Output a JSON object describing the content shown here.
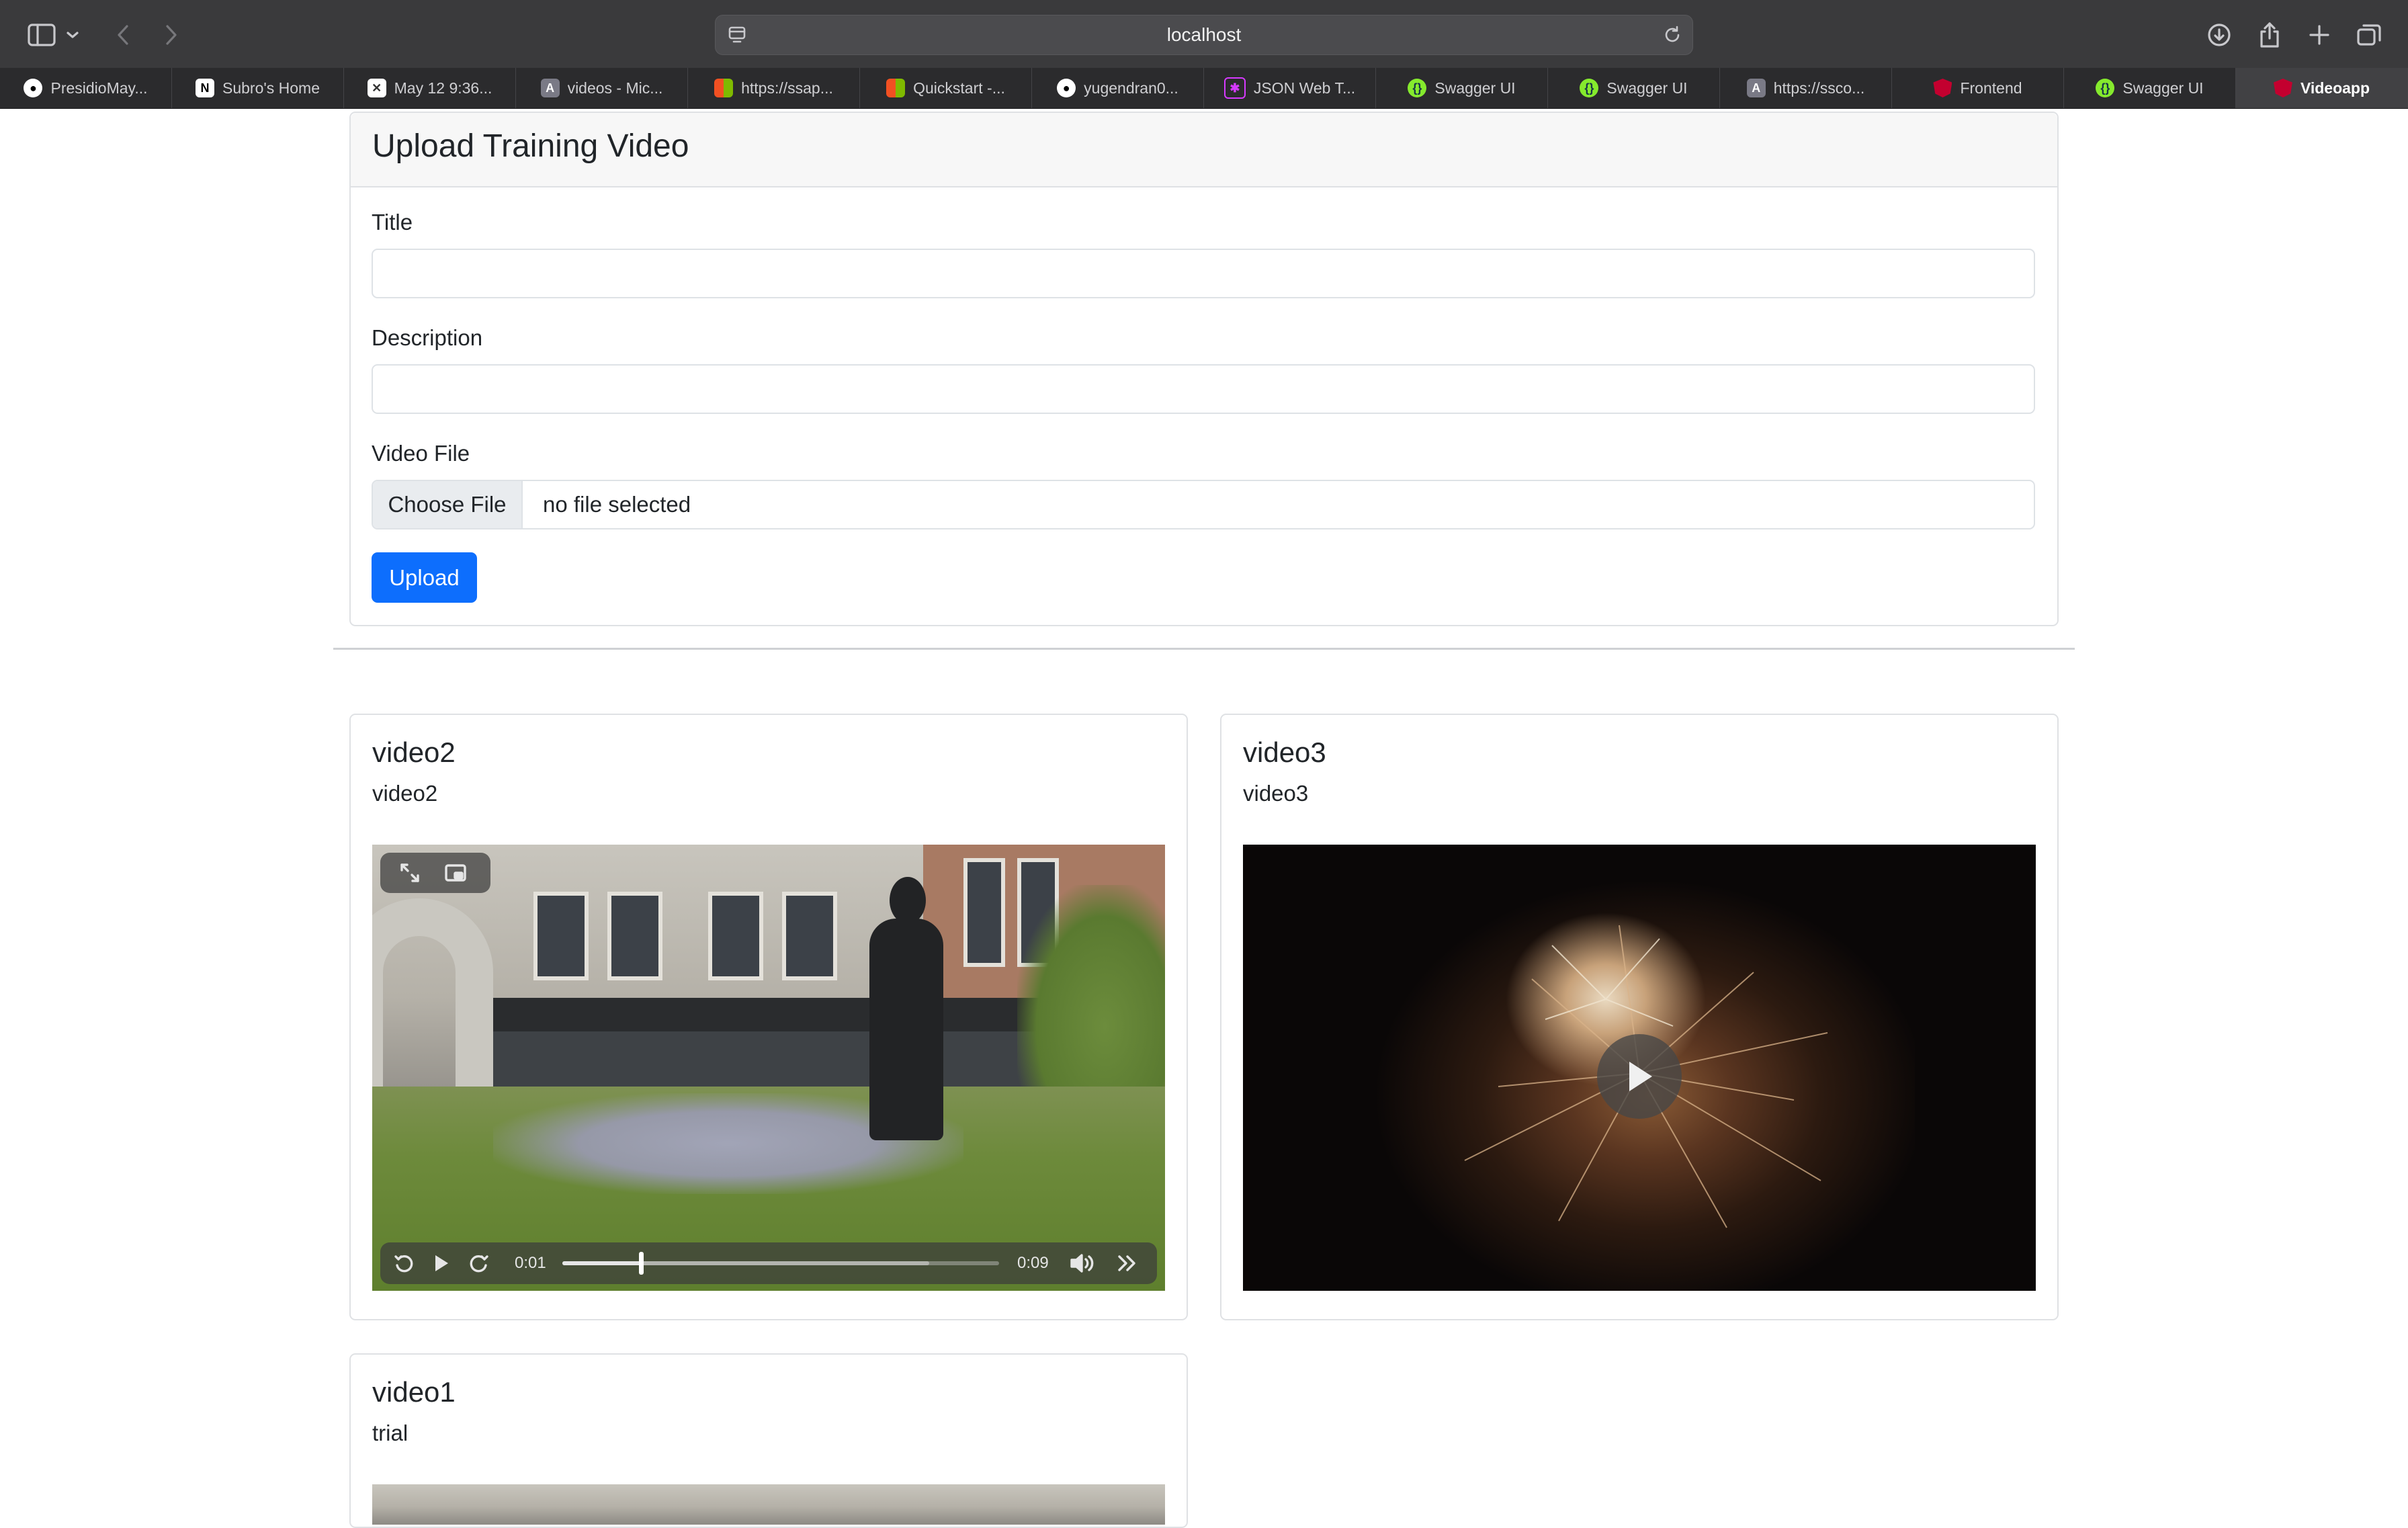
{
  "browser": {
    "address": "localhost",
    "tabs": [
      {
        "label": "PresidioMay...",
        "icon": "github-icon",
        "color": "#ffffff"
      },
      {
        "label": "Subro's Home",
        "icon": "notion-icon",
        "color": "#ffffff"
      },
      {
        "label": "May 12 9:36...",
        "icon": "calendar-app-icon",
        "color": "#ffffff"
      },
      {
        "label": "videos - Mic...",
        "icon": "azure-icon",
        "color": "#7a7a86"
      },
      {
        "label": "https://ssap...",
        "icon": "microsoft-icon",
        "color": "#f25022"
      },
      {
        "label": "Quickstart -...",
        "icon": "microsoft-icon",
        "color": "#f25022"
      },
      {
        "label": "yugendran0...",
        "icon": "github-icon",
        "color": "#ffffff"
      },
      {
        "label": "JSON Web T...",
        "icon": "jwt-icon",
        "color": "#d63aff"
      },
      {
        "label": "Swagger UI",
        "icon": "swagger-icon",
        "color": "#85ea2d"
      },
      {
        "label": "Swagger UI",
        "icon": "swagger-icon",
        "color": "#85ea2d"
      },
      {
        "label": "https://ssco...",
        "icon": "azure-icon",
        "color": "#7a7a86"
      },
      {
        "label": "Frontend",
        "icon": "angular-icon",
        "color": "#c3002f"
      },
      {
        "label": "Swagger UI",
        "icon": "swagger-icon",
        "color": "#85ea2d"
      },
      {
        "label": "Videoapp",
        "icon": "angular-icon",
        "color": "#c3002f",
        "active": true
      }
    ]
  },
  "upload_form": {
    "heading": "Upload Training Video",
    "title_label": "Title",
    "title_value": "",
    "description_label": "Description",
    "description_value": "",
    "file_label": "Video File",
    "choose_file_label": "Choose File",
    "file_status": "no file selected",
    "upload_button": "Upload",
    "accent_color": "#0d6efd"
  },
  "videos": [
    {
      "title": "video2",
      "description": "video2",
      "current_time": "0:01",
      "duration": "0:09",
      "progress": 0.18,
      "buffered": 0.84
    },
    {
      "title": "video3",
      "description": "video3"
    },
    {
      "title": "video1",
      "description": "trial"
    }
  ]
}
